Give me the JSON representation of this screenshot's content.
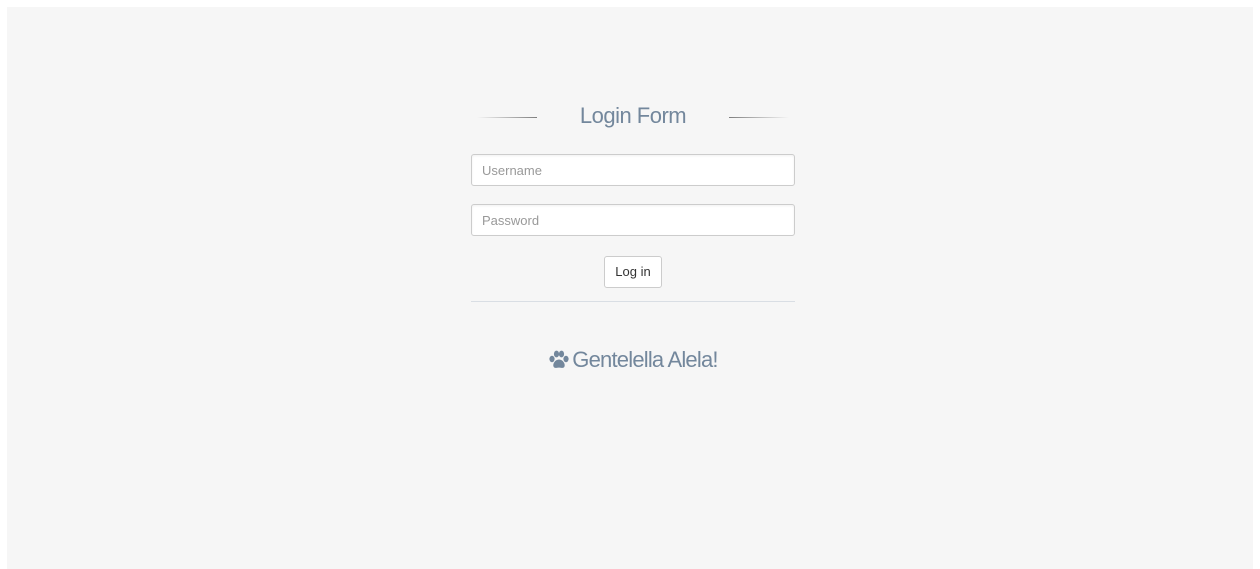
{
  "form": {
    "title": "Login Form",
    "username_placeholder": "Username",
    "password_placeholder": "Password",
    "submit_label": "Log in"
  },
  "brand": {
    "icon": "paw-icon",
    "name": "Gentelella Alela!"
  },
  "colors": {
    "background": "#f6f6f6",
    "text_accent": "#73879c",
    "border": "#cccccc"
  }
}
